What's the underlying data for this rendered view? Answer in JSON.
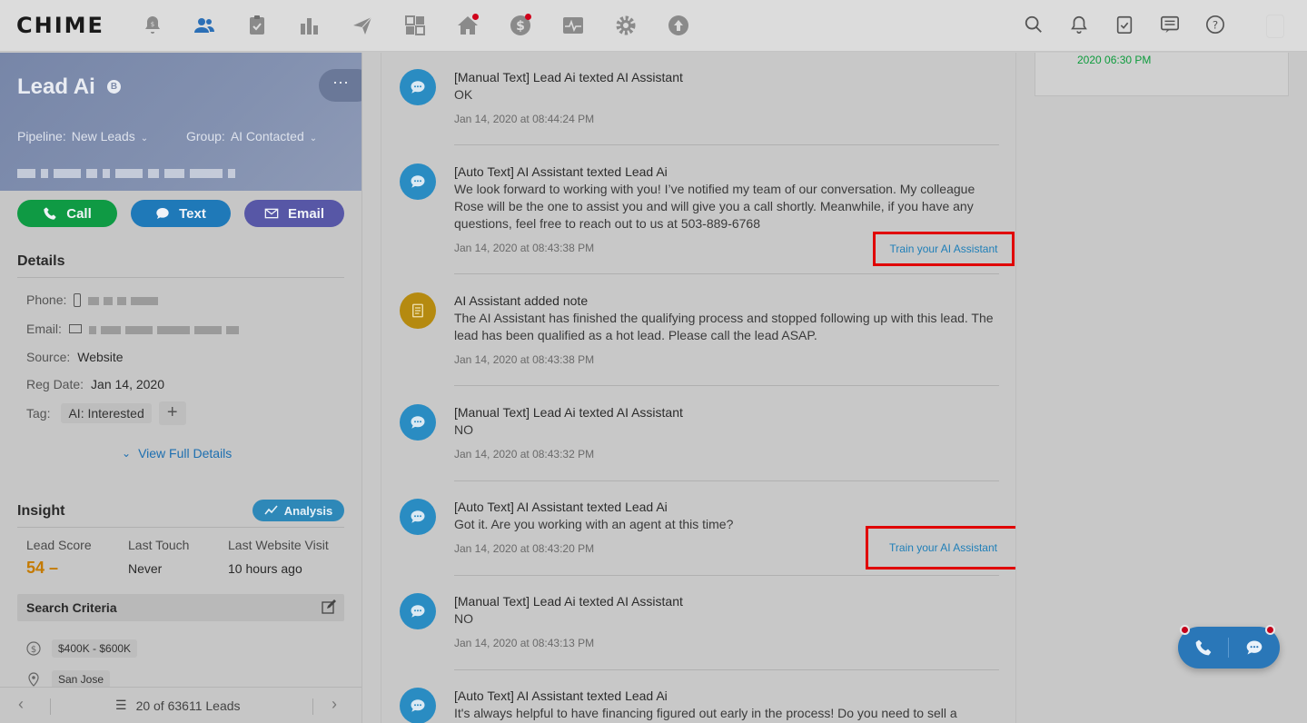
{
  "app": {
    "logo": "CHIME"
  },
  "nav_icons": [
    "bell-dollar-icon",
    "people-icon",
    "clipboard-check-icon",
    "bar-chart-icon",
    "paper-plane-icon",
    "dashboard-grid-icon",
    "home-icon",
    "dollar-circle-icon",
    "activity-icon",
    "gear-icon",
    "upload-icon"
  ],
  "right_icons": [
    "search-icon",
    "bell-icon",
    "task-icon",
    "message-icon",
    "help-icon"
  ],
  "lead": {
    "name": "Lead Ai",
    "badge": "B",
    "more": "⋯",
    "pipeline_label": "Pipeline:",
    "pipeline_value": "New Leads",
    "group_label": "Group:",
    "group_value": "AI Contacted"
  },
  "actions": {
    "call": "Call",
    "text": "Text",
    "email": "Email"
  },
  "details": {
    "title": "Details",
    "phone_label": "Phone:",
    "email_label": "Email:",
    "source_label": "Source:",
    "source_value": "Website",
    "reg_label": "Reg Date:",
    "reg_value": "Jan 14, 2020",
    "tag_label": "Tag:",
    "tag_value": "AI: Interested",
    "add_tag": "+",
    "view_full": "View Full Details"
  },
  "insight": {
    "title": "Insight",
    "analysis": "Analysis",
    "lead_score_label": "Lead Score",
    "lead_score_value": "54 –",
    "last_touch_label": "Last Touch",
    "last_touch_value": "Never",
    "last_visit_label": "Last Website Visit",
    "last_visit_value": "10 hours ago",
    "search_criteria": "Search Criteria",
    "price_range": "$400K - $600K",
    "location": "San Jose"
  },
  "pager": {
    "text": "20 of 63611 Leads"
  },
  "right_card": {
    "time": "2020 06:30 PM"
  },
  "feed": [
    {
      "title": "[Manual Text] Lead Ai texted AI Assistant",
      "body": "OK",
      "time": "Jan 14, 2020 at 08:44:24 PM",
      "train": ""
    },
    {
      "title": "[Auto Text] AI Assistant texted Lead Ai",
      "body": "We look forward to working with you! I’ve notified my team of our conversation. My colleague Rose will be the one to assist you and will give you a call shortly. Meanwhile, if you have any questions, feel free to reach out to us at 503-889-6768",
      "time": "Jan 14, 2020 at 08:43:38 PM",
      "train": "Train your AI Assistant"
    },
    {
      "title": "AI Assistant added note",
      "body": "The AI Assistant has finished the qualifying process and stopped following up with this lead. The lead has been qualified as a hot lead. Please call the lead ASAP.",
      "time": "Jan 14, 2020 at 08:43:38 PM",
      "train": ""
    },
    {
      "title": "[Manual Text] Lead Ai texted AI Assistant",
      "body": "NO",
      "time": "Jan 14, 2020 at 08:43:32 PM",
      "train": ""
    },
    {
      "title": "[Auto Text] AI Assistant texted Lead Ai",
      "body": "Got it. Are you working with an agent at this time?",
      "time": "Jan 14, 2020 at 08:43:20 PM",
      "train": "Train your AI Assistant"
    },
    {
      "title": "[Manual Text] Lead Ai texted AI Assistant",
      "body": "NO",
      "time": "Jan 14, 2020 at 08:43:13 PM",
      "train": ""
    },
    {
      "title": "[Auto Text] AI Assistant texted Lead Ai",
      "body": "It's always helpful to have financing figured out early in the process! Do you need to sell a",
      "time": "",
      "train": ""
    }
  ]
}
